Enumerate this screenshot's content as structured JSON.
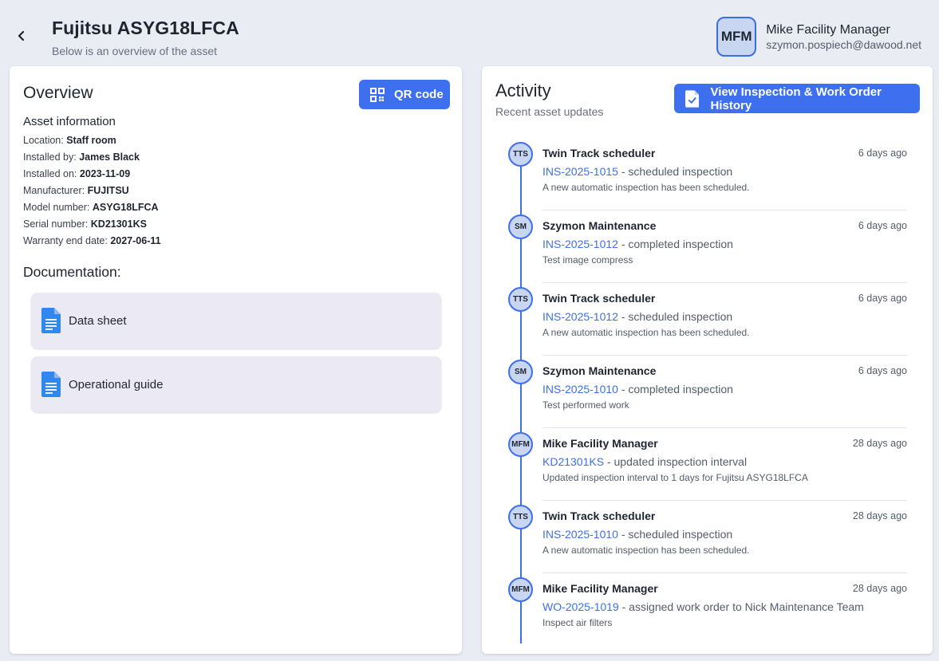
{
  "header": {
    "title": "Fujitsu ASYG18LFCA",
    "subtitle": "Below is an overview of the asset"
  },
  "user": {
    "initials": "MFM",
    "name": "Mike Facility Manager",
    "email": "szymon.pospiech@dawood.net"
  },
  "overview": {
    "title": "Overview",
    "qr_label": "QR code",
    "asset_heading": "Asset information",
    "fields": [
      {
        "label": "Location: ",
        "value": "Staff room"
      },
      {
        "label": "Installed by: ",
        "value": "James Black"
      },
      {
        "label": "Installed on: ",
        "value": "2023-11-09"
      },
      {
        "label": "Manufacturer: ",
        "value": "FUJITSU"
      },
      {
        "label": "Model number: ",
        "value": "ASYG18LFCA"
      },
      {
        "label": "Serial number: ",
        "value": "KD21301KS"
      },
      {
        "label": "Warranty end date: ",
        "value": "2027-06-11"
      }
    ],
    "documentation_title": "Documentation:",
    "documents": [
      {
        "label": "Data sheet"
      },
      {
        "label": "Operational guide"
      }
    ]
  },
  "activity": {
    "title": "Activity",
    "subtitle": "Recent asset updates",
    "history_button": "View Inspection & Work Order History",
    "items": [
      {
        "initials": "TTS",
        "author": "Twin Track scheduler",
        "time": "6 days ago",
        "ref": "INS-2025-1015",
        "action": " - scheduled inspection",
        "desc": "A new automatic inspection has been scheduled."
      },
      {
        "initials": "SM",
        "author": "Szymon Maintenance",
        "time": "6 days ago",
        "ref": "INS-2025-1012",
        "action": " - completed inspection",
        "desc": "Test image compress"
      },
      {
        "initials": "TTS",
        "author": "Twin Track scheduler",
        "time": "6 days ago",
        "ref": "INS-2025-1012",
        "action": " - scheduled inspection",
        "desc": "A new automatic inspection has been scheduled."
      },
      {
        "initials": "SM",
        "author": "Szymon Maintenance",
        "time": "6 days ago",
        "ref": "INS-2025-1010",
        "action": " - completed inspection",
        "desc": "Test performed work"
      },
      {
        "initials": "MFM",
        "author": "Mike Facility Manager",
        "time": "28 days ago",
        "ref": "KD21301KS",
        "action": " - updated inspection interval",
        "desc": "Updated inspection interval to 1 days for Fujitsu ASYG18LFCA"
      },
      {
        "initials": "TTS",
        "author": "Twin Track scheduler",
        "time": "28 days ago",
        "ref": "INS-2025-1010",
        "action": " - scheduled inspection",
        "desc": "A new automatic inspection has been scheduled."
      },
      {
        "initials": "MFM",
        "author": "Mike Facility Manager",
        "time": "28 days ago",
        "ref": "WO-2025-1019",
        "action": " - assigned work order to Nick Maintenance Team",
        "desc": "Inspect air filters"
      }
    ]
  },
  "colors": {
    "accent": "#3d6fee",
    "background": "#eaecf4",
    "avatar_fill": "#c9d6f2"
  },
  "icons": {
    "back": "chevron-left-icon",
    "qr": "qr-code-icon",
    "history": "document-check-icon",
    "document": "google-doc-icon"
  }
}
